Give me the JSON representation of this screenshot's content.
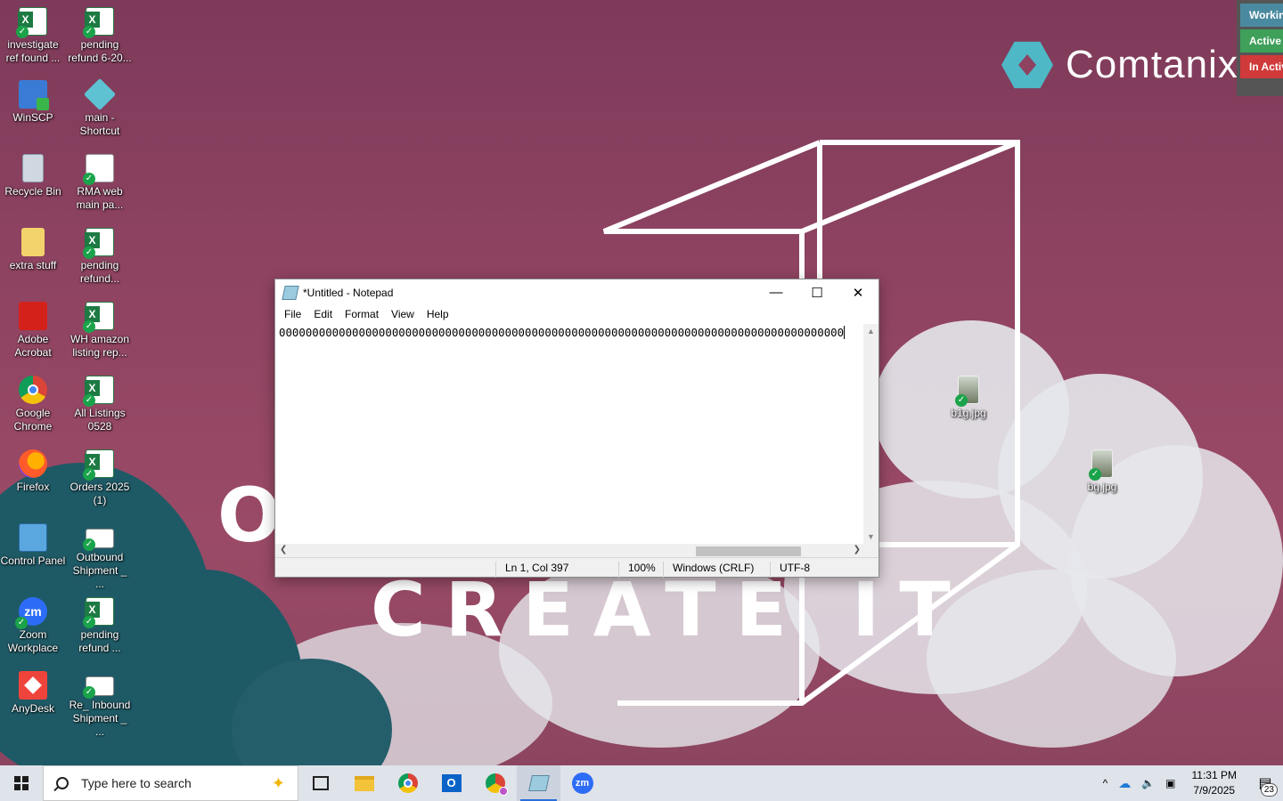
{
  "brand": {
    "name": "Comtanix"
  },
  "status_panel": [
    {
      "label": "Working",
      "color": "#4a8aa0"
    },
    {
      "label": "Active",
      "color": "#3fa05a"
    },
    {
      "label": "In Active",
      "color": "#d13a3a"
    }
  ],
  "wallpaper": {
    "slogan_top": "O",
    "slogan_bottom": "CREATE IT"
  },
  "desktop_icons": [
    {
      "label": "investigate ref found ...",
      "icon": "excel-icon"
    },
    {
      "label": "pending refund 6-20...",
      "icon": "excel-icon"
    },
    {
      "label": "WinSCP",
      "icon": "winscp-icon"
    },
    {
      "label": "main - Shortcut",
      "icon": "shortcut-icon"
    },
    {
      "label": "Recycle Bin",
      "icon": "recycle-bin-icon"
    },
    {
      "label": "RMA web main pa...",
      "icon": "web-page-icon"
    },
    {
      "label": "extra stuff",
      "icon": "folder-icon"
    },
    {
      "label": "pending refund...",
      "icon": "excel-icon"
    },
    {
      "label": "Adobe Acrobat",
      "icon": "acrobat-icon"
    },
    {
      "label": "WH amazon listing rep...",
      "icon": "excel-icon"
    },
    {
      "label": "Google Chrome",
      "icon": "chrome-icon"
    },
    {
      "label": "All Listings 0528",
      "icon": "excel-icon"
    },
    {
      "label": "Firefox",
      "icon": "firefox-icon"
    },
    {
      "label": "Orders 2025 (1)",
      "icon": "excel-icon"
    },
    {
      "label": "Control Panel",
      "icon": "control-panel-icon"
    },
    {
      "label": "Outbound Shipment _ ...",
      "icon": "mail-icon"
    },
    {
      "label": "Zoom Workplace",
      "icon": "zoom-icon"
    },
    {
      "label": "pending refund ...",
      "icon": "excel-icon"
    },
    {
      "label": "AnyDesk",
      "icon": "anydesk-icon"
    },
    {
      "label": "Re_ Inbound Shipment _ ...",
      "icon": "mail-icon"
    },
    {
      "label": "b1g.jpg",
      "icon": "image-file-icon"
    },
    {
      "label": "bg.jpg",
      "icon": "image-file-icon"
    }
  ],
  "notepad": {
    "title": "*Untitled - Notepad",
    "menu": [
      "File",
      "Edit",
      "Format",
      "View",
      "Help"
    ],
    "content": "0000000000000000000000000000000000000000000000000000000000000000000000000000000000000",
    "status": {
      "position": "Ln 1, Col 397",
      "zoom": "100%",
      "line_endings": "Windows (CRLF)",
      "encoding": "UTF-8"
    }
  },
  "taskbar": {
    "search_placeholder": "Type here to search",
    "apps": [
      "task-view-icon",
      "file-explorer-icon",
      "chrome-icon",
      "outlook-icon",
      "chrome-profile-icon",
      "notepad-icon",
      "zoom-icon"
    ],
    "time": "11:31 PM",
    "date": "7/9/2025",
    "notifications": "23"
  }
}
